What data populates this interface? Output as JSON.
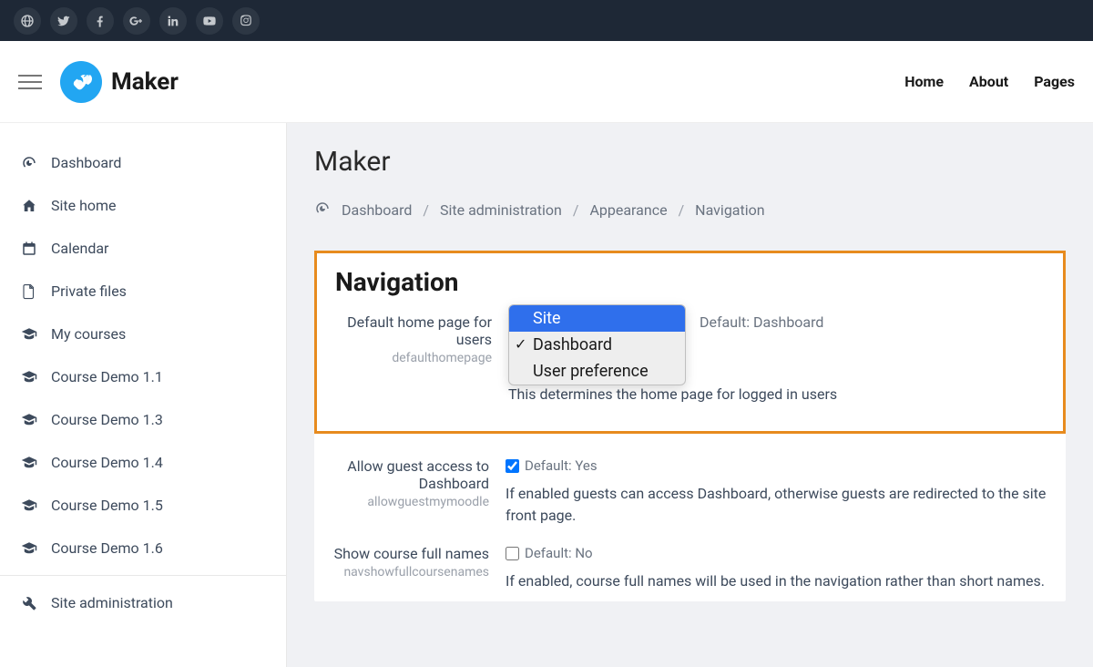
{
  "topbar": {
    "socials": [
      "globe",
      "twitter",
      "facebook",
      "googleplus",
      "linkedin",
      "youtube",
      "instagram"
    ]
  },
  "header": {
    "logo_text": "Maker",
    "nav": {
      "home": "Home",
      "about": "About",
      "pages": "Pages"
    }
  },
  "sidebar": {
    "items": [
      {
        "icon": "dashboard",
        "label": "Dashboard"
      },
      {
        "icon": "home",
        "label": "Site home"
      },
      {
        "icon": "calendar",
        "label": "Calendar"
      },
      {
        "icon": "file",
        "label": "Private files"
      },
      {
        "icon": "grad",
        "label": "My courses"
      },
      {
        "icon": "grad",
        "label": "Course Demo 1.1"
      },
      {
        "icon": "grad",
        "label": "Course Demo 1.3"
      },
      {
        "icon": "grad",
        "label": "Course Demo 1.4"
      },
      {
        "icon": "grad",
        "label": "Course Demo 1.5"
      },
      {
        "icon": "grad",
        "label": "Course Demo 1.6"
      }
    ],
    "admin_label": "Site administration"
  },
  "main": {
    "title": "Maker",
    "breadcrumb": {
      "dashboard": "Dashboard",
      "siteadmin": "Site administration",
      "appearance": "Appearance",
      "navigation": "Navigation"
    }
  },
  "settings": {
    "section_title": "Navigation",
    "default_home": {
      "label": "Default home page for users",
      "key": "defaulthomepage",
      "default_text": "Default: Dashboard",
      "help": "This determines the home page for logged in users",
      "options": {
        "site": "Site",
        "dashboard": "Dashboard",
        "userpref": "User preference"
      }
    },
    "guest": {
      "label": "Allow guest access to Dashboard",
      "key": "allowguestmymoodle",
      "default_text": "Default: Yes",
      "checked": true,
      "help": "If enabled guests can access Dashboard, otherwise guests are redirected to the site front page."
    },
    "fullnames": {
      "label": "Show course full names",
      "key": "navshowfullcoursenames",
      "default_text": "Default: No",
      "checked": false,
      "help": "If enabled, course full names will be used in the navigation rather than short names."
    }
  }
}
